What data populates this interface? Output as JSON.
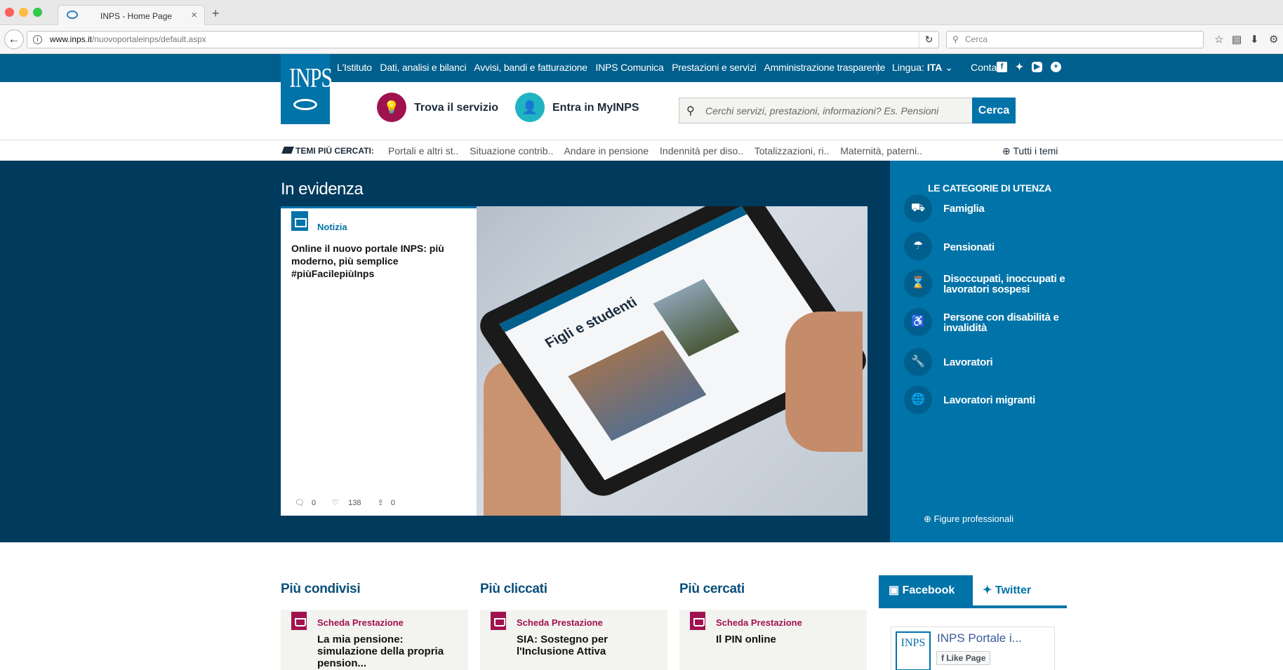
{
  "browser": {
    "tab_title": "INPS - Home Page",
    "url_domain": "www.inps.it",
    "url_path": "/nuovoportaleinps/default.aspx",
    "search_placeholder": "Cerca"
  },
  "topnav": {
    "links": [
      "L'Istituto",
      "Dati, analisi e bilanci",
      "Avvisi, bandi e fatturazione",
      "INPS Comunica",
      "Prestazioni e servizi",
      "Amministrazione trasparente"
    ],
    "lang_label": "Lingua:",
    "lang_value": "ITA",
    "contatti": "Contatti"
  },
  "logo": {
    "text": "INPS"
  },
  "header": {
    "trova": "Trova il servizio",
    "entra": "Entra in MyINPS",
    "search_placeholder": "Cerchi servizi, prestazioni, informazioni? Es. Pensioni",
    "search_button": "Cerca"
  },
  "themes": {
    "label": "TEMI PIÙ CERCATI:",
    "items": [
      "Portali e altri st..",
      "Situazione contrib..",
      "Andare in pensione",
      "Indennità per diso..",
      "Totalizzazioni, ri..",
      "Maternità, paterni.."
    ],
    "all": "Tutti i temi"
  },
  "hero": {
    "title": "In evidenza",
    "card_tag": "Notizia",
    "card_title": "Online il nuovo portale INPS: più moderno, più semplice #piùFacilepiùInps",
    "comments": "0",
    "likes": "138",
    "shares": "0",
    "image_heading": "Figli e studenti"
  },
  "categories": {
    "header": "LE CATEGORIE DI UTENZA",
    "items": [
      {
        "label": "Famiglia",
        "icon": "stroller-icon"
      },
      {
        "label": "Pensionati",
        "icon": "umbrella-icon"
      },
      {
        "label": "Disoccupati, inoccupati e lavoratori sospesi",
        "icon": "hourglass-icon"
      },
      {
        "label": "Persone con disabilità e invalidità",
        "icon": "wheelchair-icon"
      },
      {
        "label": "Lavoratori",
        "icon": "wrench-icon"
      },
      {
        "label": "Lavoratori migranti",
        "icon": "globe-icon"
      }
    ],
    "figure": "Figure professionali"
  },
  "bottom": {
    "sections": [
      "Più condivisi",
      "Più cliccati",
      "Più cercati"
    ],
    "cards": [
      {
        "tag": "Scheda Prestazione",
        "title": "La mia pensione: simulazione della propria pension..."
      },
      {
        "tag": "Scheda Prestazione",
        "title": "SIA: Sostegno per l'Inclusione Attiva"
      },
      {
        "tag": "Scheda Prestazione",
        "title": "Il PIN online"
      }
    ],
    "facebook": "Facebook",
    "twitter": "Twitter",
    "fb_page_name": "INPS Portale i...",
    "fb_like": "Like Page",
    "fb_logo_text": "INPS"
  },
  "colors": {
    "brand_blue": "#0073a8",
    "dark_blue": "#003a5d",
    "nav_blue": "#005f8c",
    "magenta": "#a0124f",
    "teal": "#1fb3c3"
  }
}
